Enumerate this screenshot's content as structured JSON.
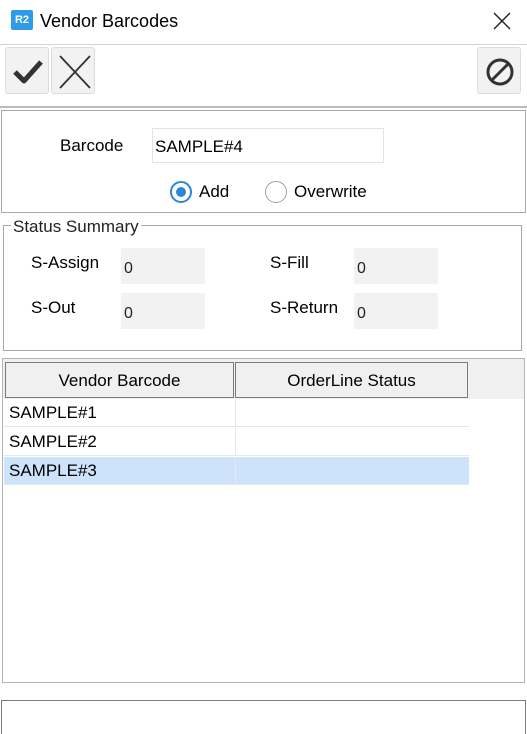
{
  "window": {
    "logo": "R2",
    "title": "Vendor Barcodes"
  },
  "toolbar": {
    "icons": [
      "check-icon",
      "cross-icon",
      "prohibit-icon"
    ]
  },
  "barcode": {
    "label": "Barcode",
    "value": "SAMPLE#4",
    "mode_options": [
      {
        "label": "Add",
        "selected": true
      },
      {
        "label": "Overwrite",
        "selected": false
      }
    ]
  },
  "status_summary": {
    "title": "Status Summary",
    "assign": {
      "label": "S-Assign",
      "value": "0"
    },
    "fill": {
      "label": "S-Fill",
      "value": "0"
    },
    "out": {
      "label": "S-Out",
      "value": "0"
    },
    "return": {
      "label": "S-Return",
      "value": "0"
    }
  },
  "grid": {
    "columns": [
      "Vendor Barcode",
      "OrderLine Status"
    ],
    "rows": [
      {
        "vendor_barcode": "SAMPLE#1",
        "status": "",
        "selected": false
      },
      {
        "vendor_barcode": "SAMPLE#2",
        "status": "",
        "selected": false
      },
      {
        "vendor_barcode": "SAMPLE#3",
        "status": "",
        "selected": true
      }
    ]
  },
  "colors": {
    "accent": "#2f86d4",
    "selection": "#cce3fb",
    "logo_bg": "#2d9be8"
  }
}
